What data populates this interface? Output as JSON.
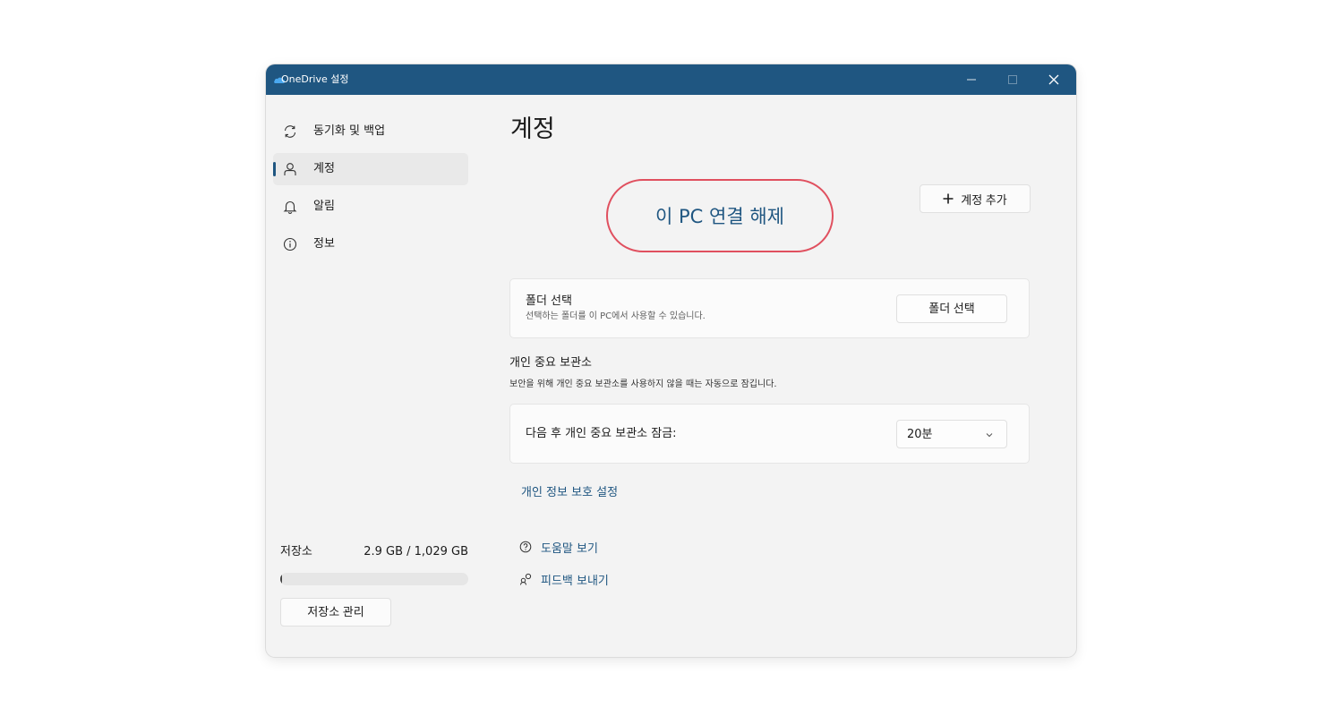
{
  "window": {
    "title": "OneDrive 설정",
    "controls": {
      "minimize": "–",
      "maximize": "□",
      "close": "✕"
    }
  },
  "sidebar": {
    "items": [
      {
        "label": "동기화 및 백업",
        "icon": "sync-icon",
        "active": false
      },
      {
        "label": "계정",
        "icon": "person-icon",
        "active": true
      },
      {
        "label": "알림",
        "icon": "bell-icon",
        "active": false
      },
      {
        "label": "정보",
        "icon": "info-icon",
        "active": false
      }
    ],
    "storage": {
      "label": "저장소",
      "value": "2.9 GB / 1,029 GB",
      "used_fraction": 0.003,
      "manage_label": "저장소 관리"
    }
  },
  "main": {
    "title": "계정",
    "disconnect_label": "이 PC 연결 해제",
    "add_account_label": "계정 추가",
    "folders_card": {
      "title": "폴더 선택",
      "description": "선택하는 폴더를 이 PC에서 사용할 수 있습니다.",
      "button_label": "폴더 선택"
    },
    "vault": {
      "title": "개인 중요 보관소",
      "description": "보안을 위해 개인 중요 보관소를 사용하지 않을 때는 자동으로 잠깁니다.",
      "lock_label": "다음 후 개인 중요 보관소 잠금:",
      "lock_value": "20분"
    },
    "privacy_link": "개인 정보 보호 설정",
    "help_link": "도움말 보기",
    "feedback_link": "피드백 보내기"
  },
  "colors": {
    "titlebar": "#1f5681",
    "accent": "#1f5681",
    "highlight_ring": "#e0505f",
    "window_bg": "#f3f3f3"
  }
}
